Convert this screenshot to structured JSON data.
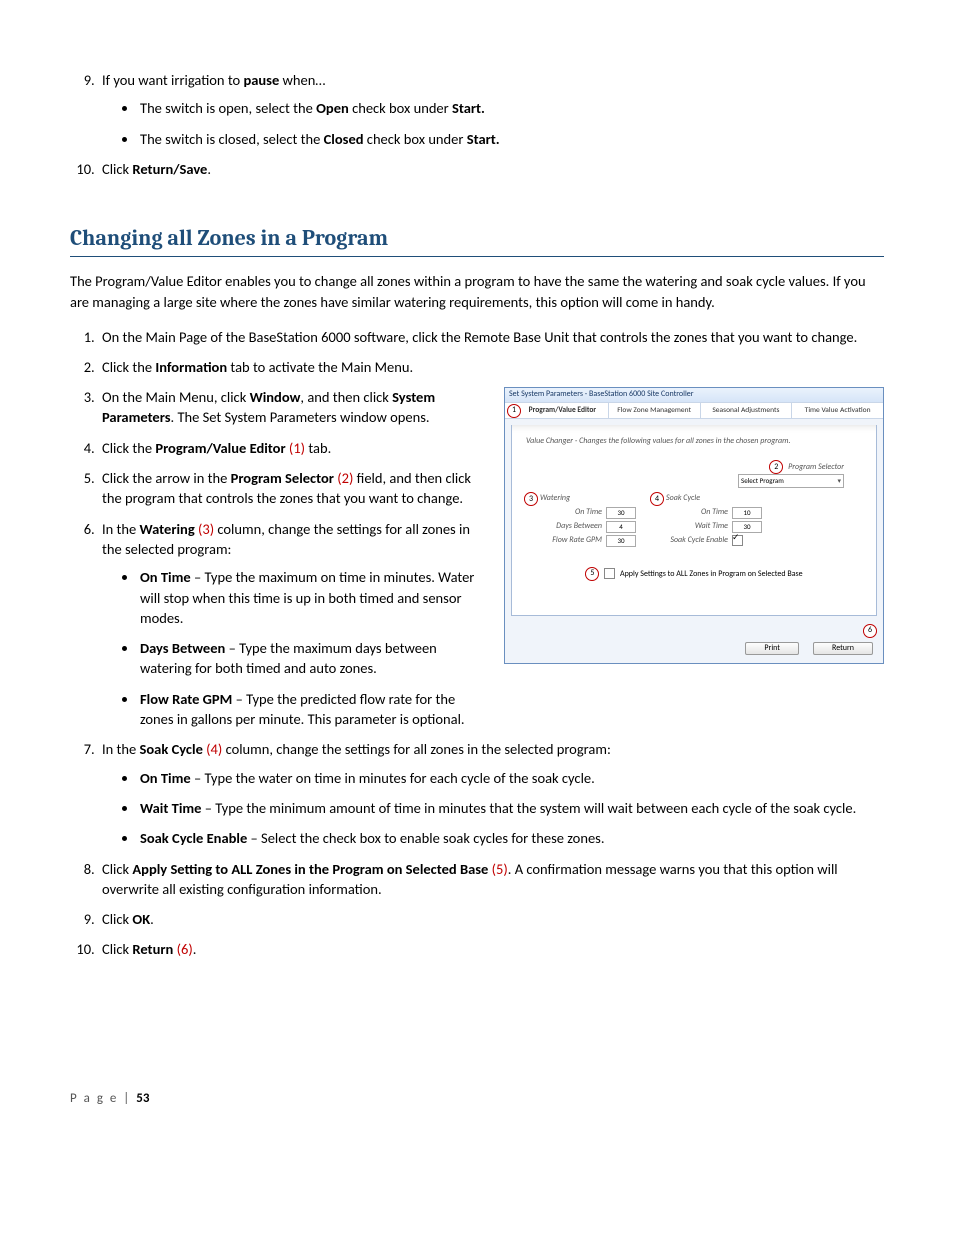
{
  "intro": {
    "item9_lead": "If you want irrigation to ",
    "item9_b": "pause",
    "item9_tail": " when…",
    "item9_sub_a1": "The switch is open, select the ",
    "item9_sub_a2": "Open",
    "item9_sub_a3": " check box under ",
    "item9_sub_a4": "Start.",
    "item9_sub_b1": "The switch is closed, select the ",
    "item9_sub_b2": "Closed",
    "item9_sub_b3": " check box under ",
    "item9_sub_b4": "Start.",
    "item10_a": "Click ",
    "item10_b": "Return/Save",
    "item10_c": "."
  },
  "heading": "Changing all Zones in a Program",
  "para": "The Program/Value Editor enables you to change all zones within a program to have the same the watering and soak cycle values. If you are managing a large site where the zones have similar watering requirements, this option will come in handy.",
  "steps": {
    "s1": "On the Main Page of the BaseStation 6000 software, click the Remote Base Unit that controls the zones that you want to change.",
    "s2a": "Click the ",
    "s2b": "Information",
    "s2c": " tab to activate the Main Menu.",
    "s3a": "On the Main Menu, click ",
    "s3b": "Window",
    "s3c": ", and then click ",
    "s3d": "System Parameters",
    "s3e": ". The Set System Parameters window opens.",
    "s4a": "Click the ",
    "s4b": "Program/Value Editor",
    "s4c": " (1)",
    "s4d": " tab.",
    "s5a": "Click the arrow in the ",
    "s5b": "Program Selector",
    "s5c": " (2)",
    "s5d": " field, and then click the program that controls the zones that you want to change.",
    "s6a": "In the ",
    "s6b": "Watering",
    "s6c": " (3)",
    "s6d": " column, change the settings for all zones in the selected program:",
    "s6_bAa": "On Time",
    "s6_bAb": " – Type the maximum on time in minutes. Water will stop when this time is up in both timed and sensor modes.",
    "s6_bBa": "Days Between",
    "s6_bBb": " – Type the maximum days between watering for both timed and auto zones.",
    "s6_bCa": "Flow Rate GPM",
    "s6_bCb": " – Type the predicted flow rate for the zones in gallons per minute. This parameter is optional.",
    "s7a": "In the ",
    "s7b": "Soak Cycle",
    "s7c": " (4)",
    "s7d": " column, change the settings for all zones in the selected program:",
    "s7_bAa": "On Time",
    "s7_bAb": " – Type the water on time in minutes for each cycle of the soak cycle.",
    "s7_bBa": "Wait Time",
    "s7_bBb": " – Type the minimum amount of time in minutes that the system will wait between each cycle of the soak cycle.",
    "s7_bCa": "Soak Cycle Enable",
    "s7_bCb": " – Select the check box to enable soak cycles for these zones.",
    "s8a": "Click ",
    "s8b": "Apply Setting to ALL Zones in the Program on Selected Base",
    "s8c": " (5)",
    "s8d": ". A confirmation message warns you that this option will overwrite all existing configuration information.",
    "s9a": "Click ",
    "s9b": "OK",
    "s9c": ".",
    "s10a": "Click ",
    "s10b": "Return",
    "s10c": " (6)",
    "s10d": "."
  },
  "fig": {
    "title": "Set System Parameters - BaseStation 6000 Site Controller",
    "tabs": [
      "Program/Value Editor",
      "Flow Zone Management",
      "Seasonal Adjustments",
      "Time Value Activation"
    ],
    "hint": "Value Changer - Changes the following values for all zones in the chosen program.",
    "selector_label": "Program Selector",
    "selector_value": "Select Program",
    "group1": "Watering",
    "group1_rows": [
      {
        "lbl": "On Time",
        "val": "30"
      },
      {
        "lbl": "Days Between",
        "val": "4"
      },
      {
        "lbl": "Flow Rate GPM",
        "val": "30"
      }
    ],
    "group2": "Soak Cycle",
    "group2_rows": [
      {
        "lbl": "On Time",
        "val": "10"
      },
      {
        "lbl": "Wait Time",
        "val": "30"
      }
    ],
    "group2_enable": "Soak Cycle Enable",
    "apply": "Apply Settings to ALL Zones in Program on Selected Base",
    "btn_print": "Print",
    "btn_return": "Return",
    "c1": "1",
    "c2": "2",
    "c3": "3",
    "c4": "4",
    "c5": "5",
    "c6": "6"
  },
  "footer": {
    "page_word": "P a g e",
    "sep": "  | ",
    "num": "53"
  }
}
